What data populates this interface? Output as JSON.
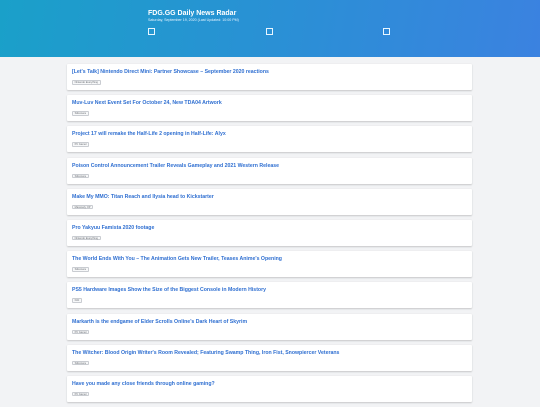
{
  "header": {
    "title": "FDG.GG Daily News Radar",
    "subtitle": "Saturday, September 19, 2020 (Last Updated: 10:00 PM)"
  },
  "articles": [
    {
      "title": "[Let's Talk] Nintendo Direct Mini: Partner Showcase – September 2020 reactions",
      "source": "Nintendo Everything"
    },
    {
      "title": "Muv-Luv Next Event Set For October 24, New TDA04 Artwork",
      "source": "Siliconera"
    },
    {
      "title": "Project 17 will remake the Half-Life 2 opening in Half-Life: Alyx",
      "source": "PC Gamer"
    },
    {
      "title": "Poison Control Announcement Trailer Reveals Gameplay and 2021 Western Release",
      "source": "Siliconera"
    },
    {
      "title": "Make My MMO: Titan Reach and Ilysia head to Kickstarter",
      "source": "Massively OP"
    },
    {
      "title": "Pro Yakyuu Famista 2020 footage",
      "source": "Nintendo Everything"
    },
    {
      "title": "The World Ends With You – The Animation Gets New Trailer, Teases Anime's Opening",
      "source": "Siliconera"
    },
    {
      "title": "PS5 Hardware Images Show the Size of the Biggest Console in Modern History",
      "source": "IGN"
    },
    {
      "title": "Markarth is the endgame of Elder Scrolls Online's Dark Heart of Skyrim",
      "source": "PC Gamer"
    },
    {
      "title": "The Witcher: Blood Origin Writer's Room Revealed; Featuring Swamp Thing, Iron Fist, Snowpiercer Veterans",
      "source": "Siliconera"
    },
    {
      "title": "Have you made any close friends through online gaming?",
      "source": "PC Gamer"
    }
  ],
  "colors": {
    "header_start": "#1aa0c9",
    "header_end": "#3b82e0",
    "link": "#2f6fd1",
    "background": "#f2f3f5"
  },
  "icons": [
    "checkbox-icon",
    "checkbox-icon",
    "checkbox-icon"
  ]
}
